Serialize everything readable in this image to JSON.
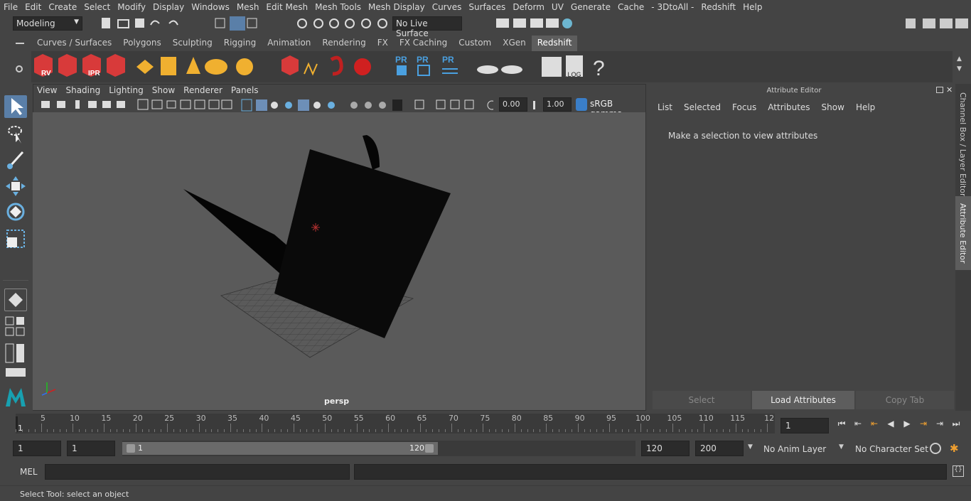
{
  "menubar": [
    "File",
    "Edit",
    "Create",
    "Select",
    "Modify",
    "Display",
    "Windows",
    "Mesh",
    "Edit Mesh",
    "Mesh Tools",
    "Mesh Display",
    "Curves",
    "Surfaces",
    "Deform",
    "UV",
    "Generate",
    "Cache",
    "- 3DtoAll -",
    "Redshift",
    "Help"
  ],
  "status": {
    "mode": "Modeling",
    "live_surface": "No Live Surface"
  },
  "shelf_tabs": [
    "Curves / Surfaces",
    "Polygons",
    "Sculpting",
    "Rigging",
    "Animation",
    "Rendering",
    "FX",
    "FX Caching",
    "Custom",
    "XGen",
    "Redshift"
  ],
  "shelf_active": "Redshift",
  "shelf_icons": {
    "rv": "RV",
    "ipr": "IPR",
    "pr": "PR",
    "log": ".LOG",
    "help": "?"
  },
  "viewport": {
    "menu": [
      "View",
      "Shading",
      "Lighting",
      "Show",
      "Renderer",
      "Panels"
    ],
    "exposure": "0.00",
    "gamma": "1.00",
    "colorspace": "sRGB gamma",
    "camera": "persp"
  },
  "attribute_editor": {
    "title": "Attribute Editor",
    "menu": [
      "List",
      "Selected",
      "Focus",
      "Attributes",
      "Show",
      "Help"
    ],
    "message": "Make a selection to view attributes",
    "buttons": {
      "select": "Select",
      "load": "Load Attributes",
      "copy": "Copy Tab"
    }
  },
  "side_tabs": {
    "channel": "Channel Box / Layer Editor",
    "attr": "Attribute Editor"
  },
  "timeline": {
    "ticks": [
      "5",
      "10",
      "15",
      "20",
      "25",
      "30",
      "35",
      "40",
      "45",
      "50",
      "55",
      "60",
      "65",
      "70",
      "75",
      "80",
      "85",
      "90",
      "95",
      "100",
      "105",
      "110",
      "115",
      "12"
    ],
    "start_marker": "1",
    "current_frame": "1"
  },
  "range": {
    "start": "1",
    "playback_start": "1",
    "slider_start": "1",
    "slider_end": "120",
    "playback_end": "120",
    "end": "200",
    "anim_layer": "No Anim Layer",
    "character_set": "No Character Set"
  },
  "command": {
    "lang": "MEL"
  },
  "help": "Select Tool: select an object"
}
